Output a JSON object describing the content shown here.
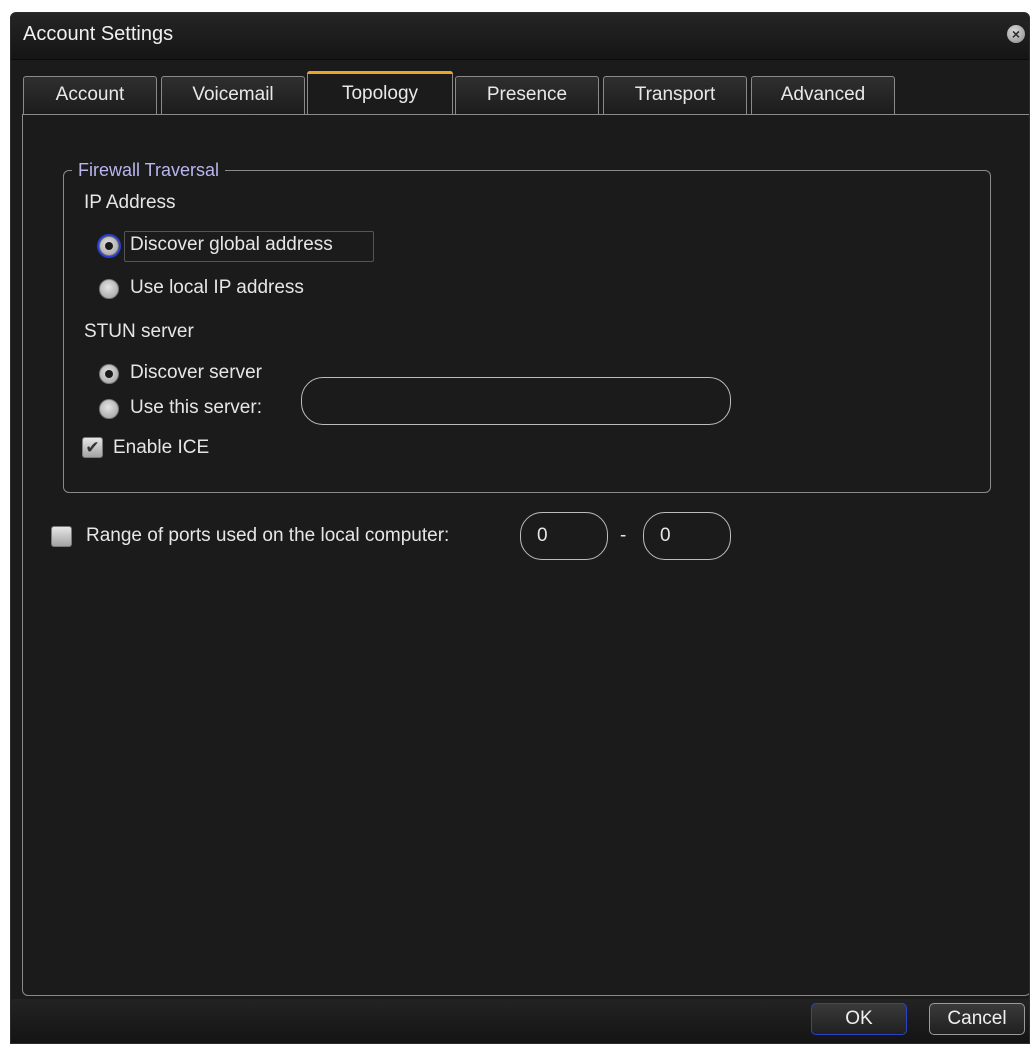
{
  "window": {
    "title": "Account Settings"
  },
  "tabs": [
    {
      "label": "Account"
    },
    {
      "label": "Voicemail"
    },
    {
      "label": "Topology"
    },
    {
      "label": "Presence"
    },
    {
      "label": "Transport"
    },
    {
      "label": "Advanced"
    }
  ],
  "active_tab": "Topology",
  "firewall": {
    "legend": "Firewall Traversal",
    "ip_heading": "IP Address",
    "ip_options": [
      {
        "label": "Discover global address",
        "selected": true
      },
      {
        "label": "Use local IP address",
        "selected": false
      }
    ],
    "stun_heading": "STUN server",
    "stun_options": [
      {
        "label": "Discover server",
        "selected": true
      },
      {
        "label": "Use this server:",
        "selected": false
      }
    ],
    "stun_server_value": "",
    "enable_ice": {
      "label": "Enable ICE",
      "checked": true
    }
  },
  "ports": {
    "label": "Range of ports used on the local computer:",
    "checked": false,
    "from": "0",
    "separator": "-",
    "to": "0"
  },
  "buttons": {
    "ok": "OK",
    "cancel": "Cancel"
  },
  "colors": {
    "accent_tab": "#e8a52a",
    "legend_text": "#b9b6ee",
    "focus": "#2a3fd6",
    "background": "#1b1b1c"
  }
}
